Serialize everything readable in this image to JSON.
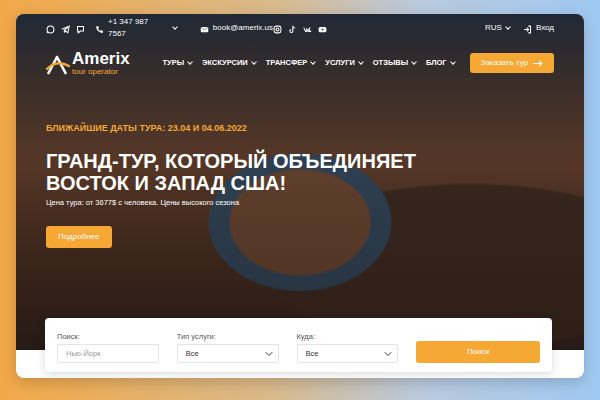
{
  "contacts": {
    "phone": "+1 347 987 7567",
    "email": "book@amerix.us"
  },
  "language": {
    "label": "RUS"
  },
  "login": {
    "label": "Вход"
  },
  "logo": {
    "name": "Amerix",
    "tagline": "tour operator"
  },
  "nav": [
    {
      "label": "ТУРЫ"
    },
    {
      "label": "ЭКСКУРСИИ"
    },
    {
      "label": "ТРАНСФЕР"
    },
    {
      "label": "УСЛУГИ"
    },
    {
      "label": "ОТЗЫВЫ"
    },
    {
      "label": "БЛОГ"
    }
  ],
  "order_button": {
    "label": "Заказать тур"
  },
  "hero": {
    "dates": "БЛИЖАЙШИЕ ДАТЫ ТУРА: 23.04 И 04.06.2022",
    "title": "ГРАНД-ТУР, КОТОРЫЙ ОБЪЕДИНЯЕТ ВОСТОК И ЗАПАД США!",
    "price": "Цена тура: от 3677$ с человека. Цены высокого сезона",
    "button": "Подробнее"
  },
  "search": {
    "fields": [
      {
        "label": "Поиск:",
        "kind": "input",
        "placeholder": "Нью-Йорк"
      },
      {
        "label": "Тип услуги:",
        "kind": "select",
        "value": "Все"
      },
      {
        "label": "Куда:",
        "kind": "select",
        "value": "Все"
      }
    ],
    "button": "Поиск"
  }
}
